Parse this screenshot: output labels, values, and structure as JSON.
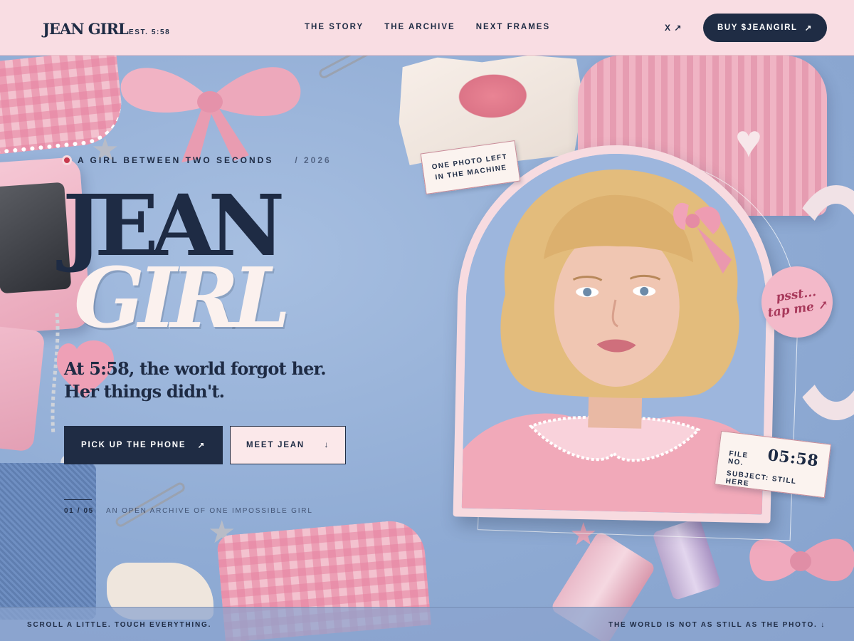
{
  "nav": {
    "logo": "JEAN GIRL",
    "est": "EST. 5:58",
    "links": [
      {
        "label": "THE STORY"
      },
      {
        "label": "THE ARCHIVE"
      },
      {
        "label": "NEXT FRAMES"
      }
    ],
    "x_link": "X ↗",
    "buy_label": "BUY $JEANGIRL",
    "buy_arrow": "↗"
  },
  "hero": {
    "eyebrow": "A GIRL BETWEEN TWO SECONDS",
    "eyebrow_year": "/ 2026",
    "title_line1": "JEAN",
    "title_line2": "GIRL",
    "tagline_line1": "At 5:58, the world forgot her.",
    "tagline_line2": "Her things didn't.",
    "cta_primary": "PICK UP THE PHONE",
    "cta_primary_arrow": "↗",
    "cta_secondary": "MEET JEAN",
    "cta_secondary_arrow": "↓",
    "counter": "01 / 05",
    "counter_caption": "AN OPEN ARCHIVE OF ONE IMPOSSIBLE GIRL"
  },
  "photo": {
    "sticker_line1": "ONE PHOTO LEFT",
    "sticker_line2": "IN THE MACHINE",
    "psst_line1": "psst...",
    "psst_line2": "tap me ↗",
    "file_label": "FILE NO.",
    "file_number": "05:58",
    "file_subject": "SUBJECT: STILL HERE"
  },
  "footer": {
    "left": "SCROLL A LITTLE. TOUCH EVERYTHING.",
    "right": "THE WORLD IS NOT AS STILL AS THE PHOTO. ↓"
  },
  "colors": {
    "navy": "#1f2c44",
    "pink_bar": "#f9dde3",
    "sky": "#92aed6",
    "rec": "#c73a4e"
  },
  "icons": {
    "rec": "record-dot-icon",
    "arrow_up_right": "arrow-up-right-icon",
    "arrow_down": "arrow-down-icon"
  }
}
